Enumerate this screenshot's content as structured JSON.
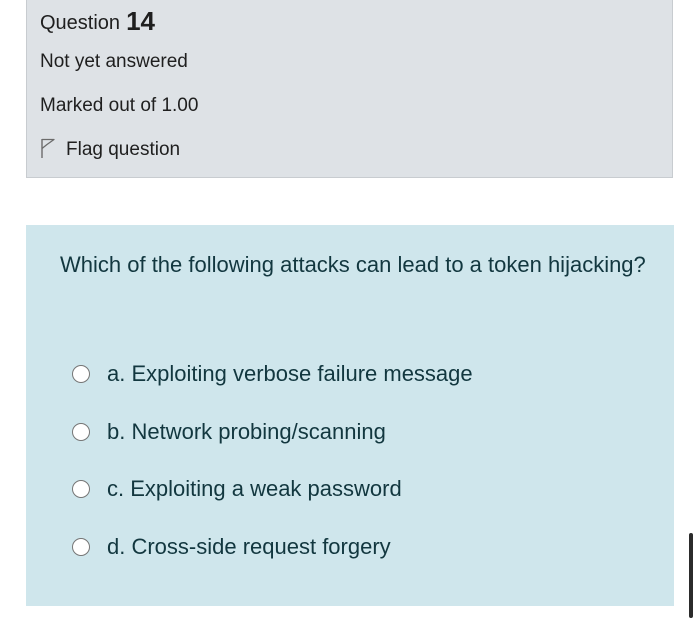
{
  "info": {
    "question_label": "Question",
    "question_number": "14",
    "state": "Not yet answered",
    "grade": "Marked out of 1.00",
    "flag_label": "Flag question",
    "flag_icon": "flag-outline-icon"
  },
  "question": {
    "text": "Which of the following attacks can lead to a token hijacking?",
    "answers": [
      {
        "label": "a. Exploiting verbose failure message",
        "selected": false
      },
      {
        "label": "b. Network probing/scanning",
        "selected": false
      },
      {
        "label": "c. Exploiting a weak password",
        "selected": false
      },
      {
        "label": "d. Cross-side request forgery",
        "selected": false
      }
    ]
  },
  "colors": {
    "info_background": "#dee2e6",
    "question_background": "#cfe6ec",
    "question_text": "#12373f"
  }
}
